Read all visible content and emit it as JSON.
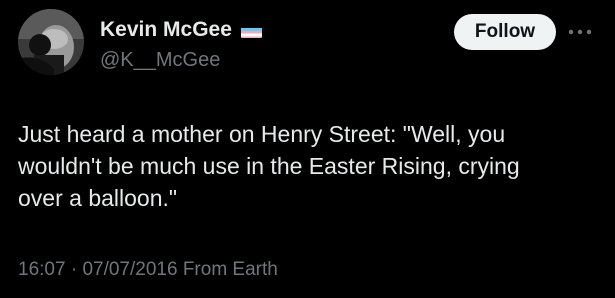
{
  "author": {
    "display_name": "Kevin McGee",
    "handle": "@K__McGee",
    "avatar_icon": "profile-photo",
    "flag_icon": "trans-flag-icon",
    "flag_colors": [
      "#5bcefa",
      "#f5a9b8",
      "#ffffff",
      "#f5a9b8",
      "#5bcefa"
    ]
  },
  "actions": {
    "follow_label": "Follow",
    "more_icon": "more-options-icon"
  },
  "tweet": {
    "text": "Just heard a mother on Henry Street: \"Well, you\nwouldn't be much use in the Easter Rising, crying\nover a balloon.\""
  },
  "meta": {
    "time": "16:07",
    "separator": "·",
    "date": "07/07/2016",
    "source": "From Earth"
  },
  "colors": {
    "background": "#000000",
    "primary_text": "#e7e9ea",
    "secondary_text": "#71767b",
    "button_bg": "#eff3f4",
    "button_text": "#0f1419"
  }
}
